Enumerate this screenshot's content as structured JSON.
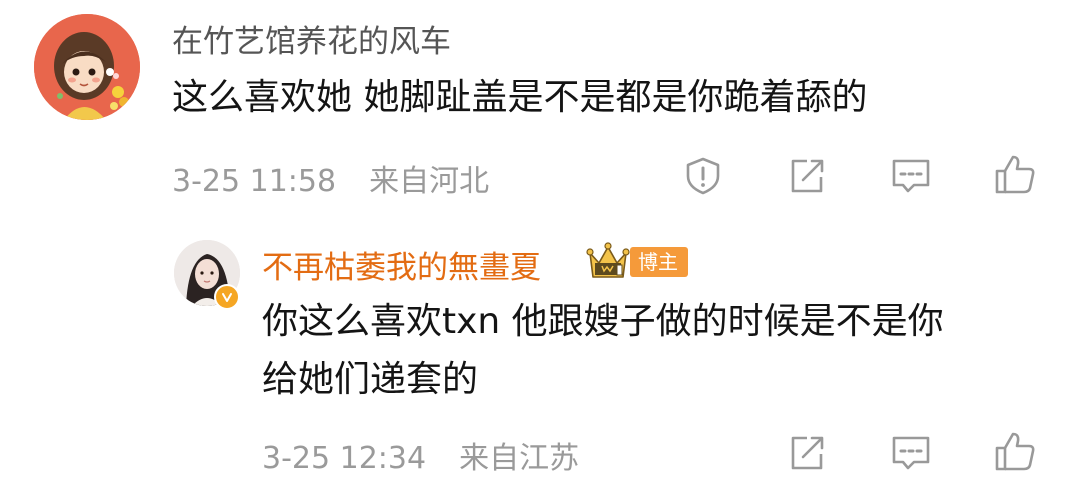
{
  "comment": {
    "username": "在竹艺馆养花的风车",
    "text": "这么喜欢她  她脚趾盖是不是都是你跪着舔的",
    "timestamp": "3-25 11:58",
    "location": "来自河北",
    "actions": [
      "report-icon",
      "share-icon",
      "reply-icon",
      "like-icon"
    ]
  },
  "reply": {
    "username": "不再枯萎我的無畫夏",
    "badge_label": "博主",
    "text_line1": "你这么喜欢txn 他跟嫂子做的时候是不是你",
    "text_line2": "给她们递套的",
    "timestamp": "3-25 12:34",
    "location": "来自江苏",
    "actions": [
      "share-icon",
      "reply-icon",
      "like-icon"
    ]
  },
  "colors": {
    "username_reply": "#e36c13",
    "meta_text": "#9a9a9a",
    "content_text": "#141414",
    "verified_badge": "#f5a623"
  }
}
